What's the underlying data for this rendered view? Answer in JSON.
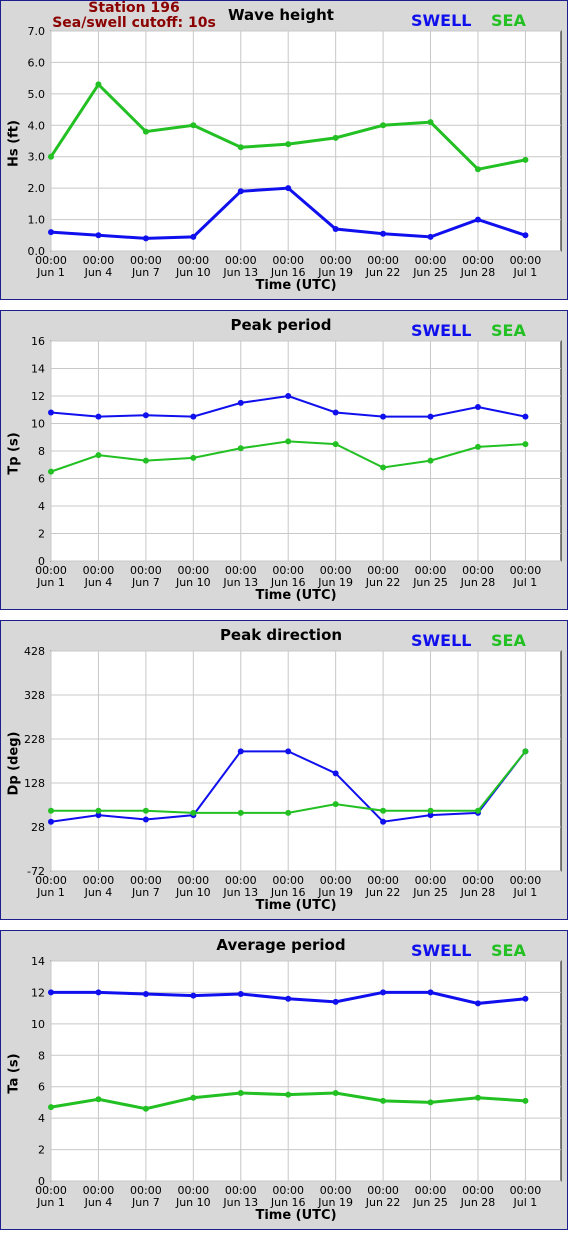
{
  "station": {
    "name": "Station 196",
    "cutoff": "Sea/swell cutoff: 10s"
  },
  "legend": {
    "swell": "SWELL",
    "sea": "SEA"
  },
  "colors": {
    "swell": "#1010ee",
    "sea": "#22c022"
  },
  "x_axis": {
    "label": "Time (UTC)",
    "tick_time": "00:00",
    "ticks": [
      "Jun 1",
      "Jun 4",
      "Jun 7",
      "Jun 10",
      "Jun 13",
      "Jun 16",
      "Jun 19",
      "Jun 22",
      "Jun 25",
      "Jun 28",
      "Jul 1"
    ]
  },
  "chart_data": [
    {
      "type": "line",
      "title": "Wave height",
      "ylabel": "Hs (ft)",
      "ylim": [
        0,
        7
      ],
      "yticks": [
        "0.0",
        "1.0",
        "2.0",
        "3.0",
        "4.0",
        "5.0",
        "6.0",
        "7.0"
      ],
      "x": [
        "Jun 1",
        "Jun 4",
        "Jun 7",
        "Jun 10",
        "Jun 13",
        "Jun 16",
        "Jun 19",
        "Jun 22",
        "Jun 25",
        "Jun 28",
        "Jul 1"
      ],
      "series": [
        {
          "name": "SWELL",
          "values": [
            0.6,
            0.5,
            0.4,
            0.45,
            1.9,
            2.0,
            0.7,
            0.55,
            0.45,
            1.0,
            0.5
          ]
        },
        {
          "name": "SEA",
          "values": [
            3.0,
            5.3,
            3.8,
            4.0,
            3.3,
            3.4,
            3.6,
            4.0,
            4.1,
            2.6,
            2.9
          ]
        }
      ]
    },
    {
      "type": "scatter",
      "title": "Peak period",
      "ylabel": "Tp (s)",
      "ylim": [
        0,
        16
      ],
      "yticks": [
        "0",
        "2",
        "4",
        "6",
        "8",
        "10",
        "12",
        "14",
        "16"
      ],
      "x": [
        "Jun 1",
        "Jun 4",
        "Jun 7",
        "Jun 10",
        "Jun 13",
        "Jun 16",
        "Jun 19",
        "Jun 22",
        "Jun 25",
        "Jun 28",
        "Jul 1"
      ],
      "series": [
        {
          "name": "SWELL",
          "values": [
            10.8,
            10.5,
            10.6,
            10.5,
            11.5,
            12.0,
            10.8,
            10.5,
            10.5,
            11.2,
            10.5
          ]
        },
        {
          "name": "SEA",
          "values": [
            6.5,
            7.7,
            7.3,
            7.5,
            8.2,
            8.7,
            8.5,
            6.8,
            7.3,
            8.3,
            8.5
          ]
        }
      ]
    },
    {
      "type": "scatter",
      "title": "Peak direction",
      "ylabel": "Dp (deg)",
      "ylim": [
        -72,
        428
      ],
      "yticks": [
        "-72",
        "28",
        "128",
        "228",
        "328",
        "428"
      ],
      "x": [
        "Jun 1",
        "Jun 4",
        "Jun 7",
        "Jun 10",
        "Jun 13",
        "Jun 16",
        "Jun 19",
        "Jun 22",
        "Jun 25",
        "Jun 28",
        "Jul 1"
      ],
      "series": [
        {
          "name": "SWELL",
          "values": [
            40,
            55,
            45,
            55,
            200,
            200,
            150,
            40,
            55,
            60,
            200
          ]
        },
        {
          "name": "SEA",
          "values": [
            65,
            65,
            65,
            60,
            60,
            60,
            80,
            65,
            65,
            65,
            200
          ]
        }
      ]
    },
    {
      "type": "line",
      "title": "Average period",
      "ylabel": "Ta (s)",
      "ylim": [
        0,
        14
      ],
      "yticks": [
        "0",
        "2",
        "4",
        "6",
        "8",
        "10",
        "12",
        "14"
      ],
      "x": [
        "Jun 1",
        "Jun 4",
        "Jun 7",
        "Jun 10",
        "Jun 13",
        "Jun 16",
        "Jun 19",
        "Jun 22",
        "Jun 25",
        "Jun 28",
        "Jul 1"
      ],
      "series": [
        {
          "name": "SWELL",
          "values": [
            12.0,
            12.0,
            11.9,
            11.8,
            11.9,
            11.6,
            11.4,
            12.0,
            12.0,
            11.3,
            11.6
          ]
        },
        {
          "name": "SEA",
          "values": [
            4.7,
            5.2,
            4.6,
            5.3,
            5.6,
            5.5,
            5.6,
            5.1,
            5.0,
            5.3,
            5.1
          ]
        }
      ]
    }
  ]
}
